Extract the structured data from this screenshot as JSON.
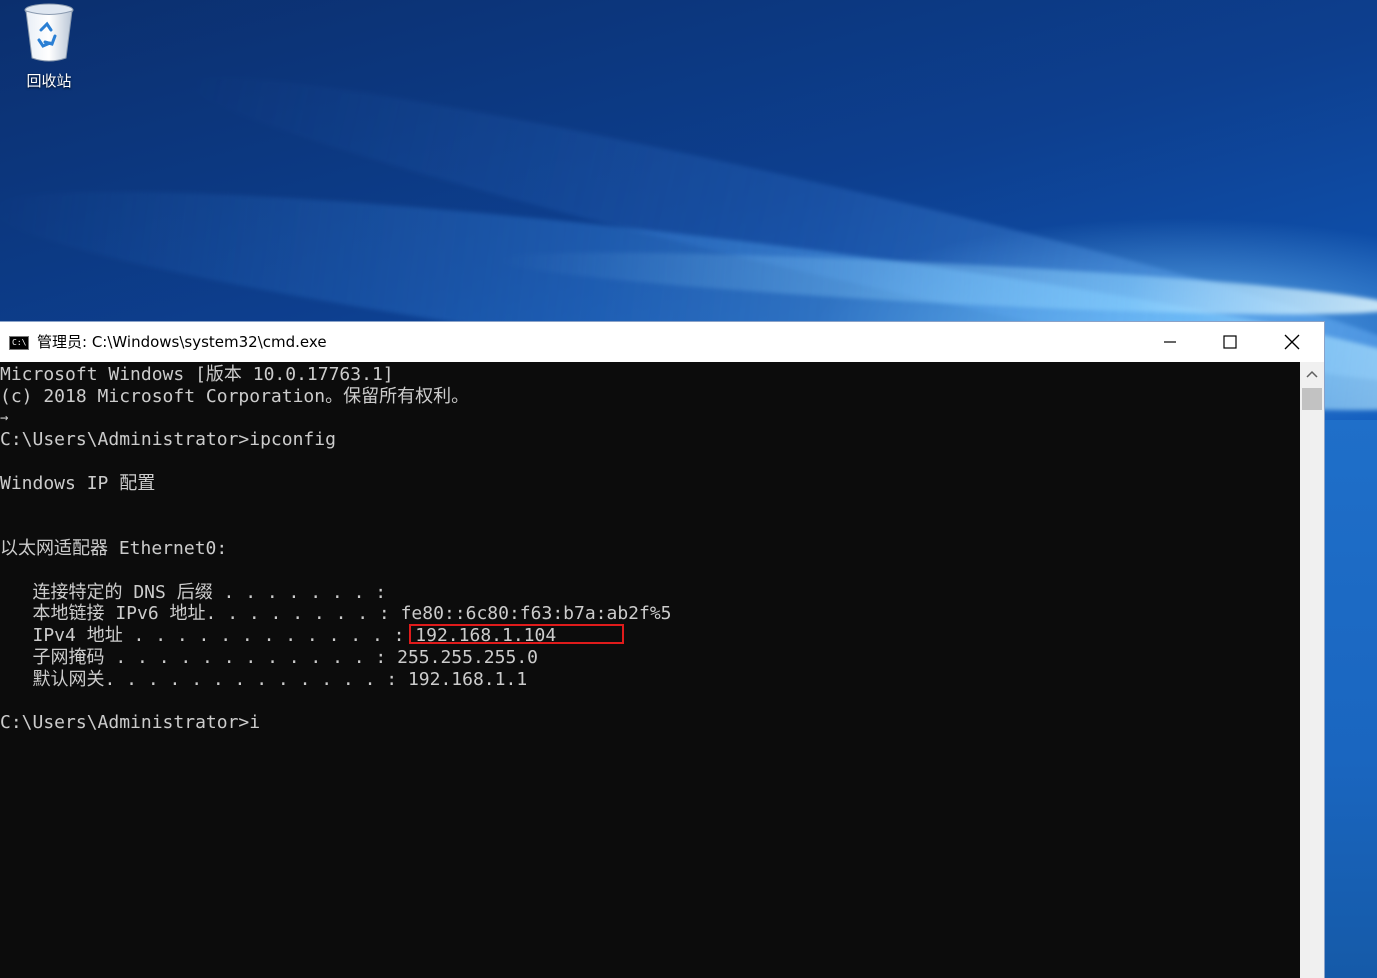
{
  "desktop": {
    "recycle_bin_label": "回收站"
  },
  "window": {
    "title": "管理员: C:\\Windows\\system32\\cmd.exe",
    "icon_text": "C:\\",
    "buttons": {
      "minimize": "minimize-icon",
      "maximize": "maximize-icon",
      "close": "close-icon"
    }
  },
  "console": {
    "lines": [
      "Microsoft Windows [版本 10.0.17763.1]",
      "(c) 2018 Microsoft Corporation。保留所有权利。",
      "→",
      "C:\\Users\\Administrator>ipconfig",
      "Windows IP 配置",
      "以太网适配器 Ethernet0:",
      "   连接特定的 DNS 后缀 . . . . . . . :",
      "   本地链接 IPv6 地址. . . . . . . . : fe80::6c80:f63:b7a:ab2f%5",
      "   IPv4 地址 . . . . . . . . . . . . : 192.168.1.104",
      "   子网掩码 . . . . . . . . . . . . : 255.255.255.0",
      "   默认网关. . . . . . . . . . . . . : 192.168.1.1",
      "C:\\Users\\Administrator>i"
    ]
  },
  "colors": {
    "console_bg": "#0c0c0c",
    "console_text": "#cccccc",
    "highlight": "#e01b1b"
  }
}
